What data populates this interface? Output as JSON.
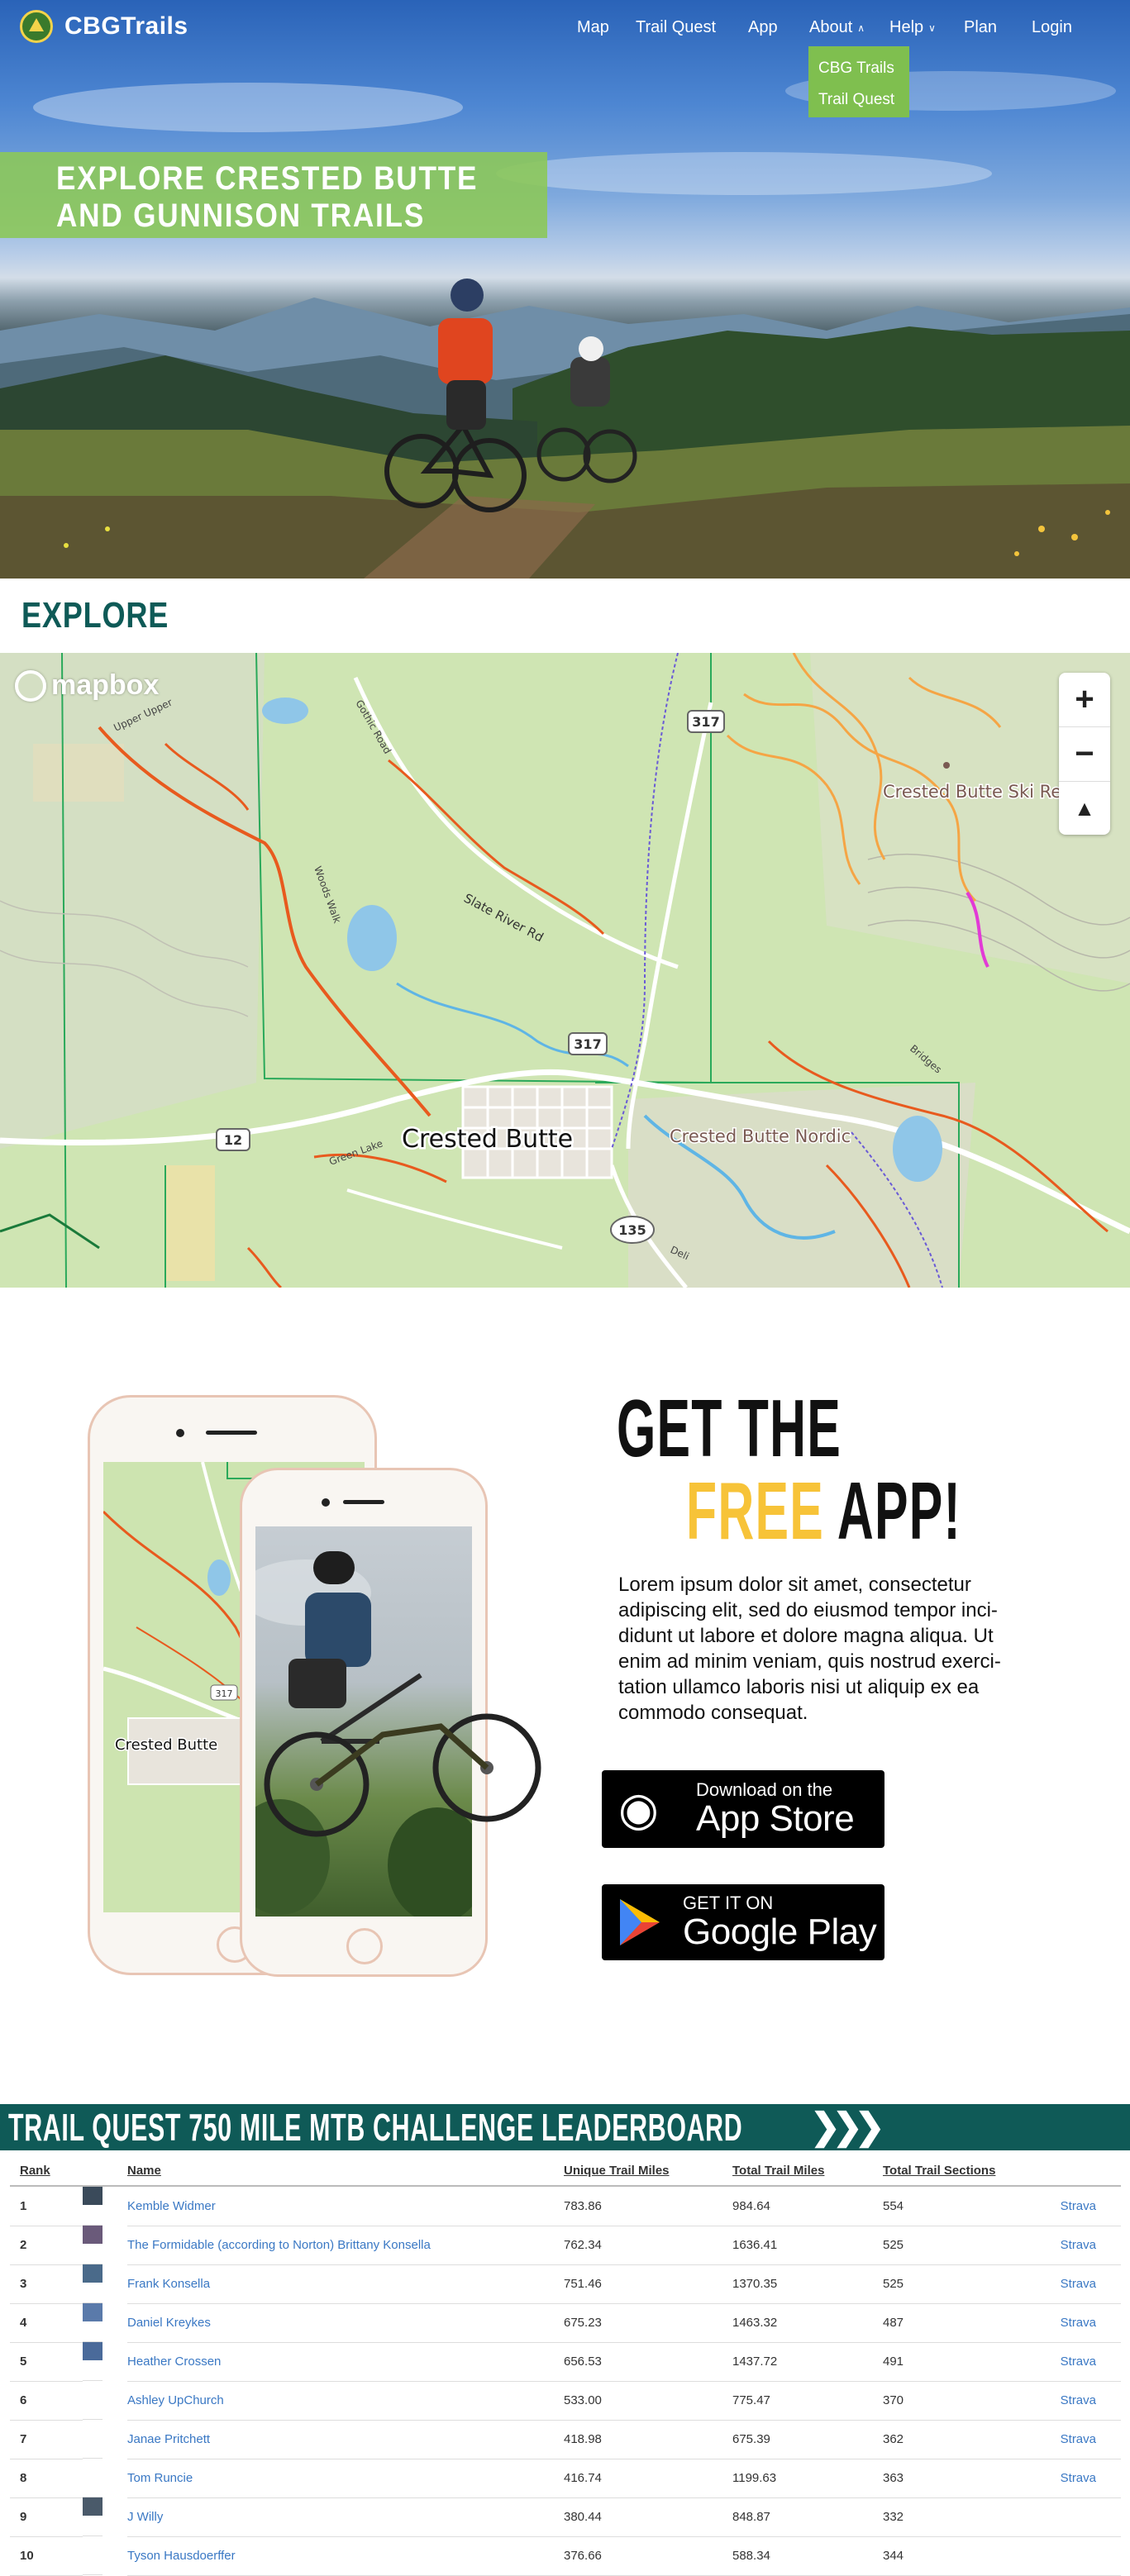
{
  "brand": {
    "name": "CBGTrails",
    "accent": "#7fbf4f",
    "dark_teal": "#0f5a57",
    "yellow": "#f7c338"
  },
  "nav": {
    "items": [
      {
        "label": "Map"
      },
      {
        "label": "Trail Quest"
      },
      {
        "label": "App"
      },
      {
        "label": "About",
        "has_caret": true
      },
      {
        "label": "Help",
        "has_caret": true
      },
      {
        "label": "Plan"
      },
      {
        "label": "Login"
      }
    ],
    "about_dropdown": [
      "CBG Trails",
      "Trail Quest"
    ]
  },
  "hero": {
    "title": "Explore Crested Butte and Gunnison Trails"
  },
  "explore": {
    "heading": "EXPLORE",
    "map": {
      "attribution": "mapbox",
      "labels": [
        "Crested Butte",
        "Crested Butte Ski Resort",
        "Crested Butte Nordic",
        "Slate River Rd",
        "Gothic Road",
        "Upper Upper",
        "Woods Walk",
        "Green Lake",
        "Deli",
        "Bridges"
      ],
      "road_shields": [
        "317",
        "317",
        "12",
        "135"
      ],
      "controls": {
        "zoom_in": "+",
        "zoom_out": "−",
        "compass": "▲"
      }
    }
  },
  "promo": {
    "line1": "GET THE",
    "free_word": "FREE",
    "app_word": "APP!",
    "body": "Lorem ipsum dolor sit amet, consectetur adipiscing elit, sed do eiusmod tempor inci-didunt ut labore et dolore magna aliqua. Ut enim ad minim veniam, quis nostrud exerci-tation ullamco laboris nisi ut aliquip ex ea commodo consequat.",
    "phone_map_label": "Crested Butte",
    "appstore": {
      "small": "Download on the",
      "big": "App Store"
    },
    "googleplay": {
      "small": "GET IT ON",
      "big": "Google Play"
    }
  },
  "leaderboard": {
    "title": "TRAIL QUEST 750 MILE MTB CHALLENGE LEADERBOARD",
    "columns": {
      "rank": "Rank",
      "name": "Name",
      "unique": "Unique Trail Miles",
      "total": "Total Trail Miles",
      "sections": "Total Trail Sections"
    },
    "rows": [
      {
        "rank": "1",
        "name": "Kemble Widmer",
        "unique": "783.86",
        "total": "984.64",
        "sections": "554",
        "strava": "Strava",
        "has_avatar": true
      },
      {
        "rank": "2",
        "name": "The Formidable (according to Norton) Brittany Konsella",
        "unique": "762.34",
        "total": "1636.41",
        "sections": "525",
        "strava": "Strava",
        "has_avatar": true
      },
      {
        "rank": "3",
        "name": "Frank Konsella",
        "unique": "751.46",
        "total": "1370.35",
        "sections": "525",
        "strava": "Strava",
        "has_avatar": true
      },
      {
        "rank": "4",
        "name": "Daniel Kreykes",
        "unique": "675.23",
        "total": "1463.32",
        "sections": "487",
        "strava": "Strava",
        "has_avatar": true
      },
      {
        "rank": "5",
        "name": "Heather Crossen",
        "unique": "656.53",
        "total": "1437.72",
        "sections": "491",
        "strava": "Strava",
        "has_avatar": true
      },
      {
        "rank": "6",
        "name": "Ashley UpChurch",
        "unique": "533.00",
        "total": "775.47",
        "sections": "370",
        "strava": "Strava",
        "has_avatar": false
      },
      {
        "rank": "7",
        "name": "Janae Pritchett",
        "unique": "418.98",
        "total": "675.39",
        "sections": "362",
        "strava": "Strava",
        "has_avatar": false
      },
      {
        "rank": "8",
        "name": "Tom Runcie",
        "unique": "416.74",
        "total": "1199.63",
        "sections": "363",
        "strava": "Strava",
        "has_avatar": false
      },
      {
        "rank": "9",
        "name": "J Willy",
        "unique": "380.44",
        "total": "848.87",
        "sections": "332",
        "strava": "",
        "has_avatar": true
      },
      {
        "rank": "10",
        "name": "Tyson Hausdoerffer",
        "unique": "376.66",
        "total": "588.34",
        "sections": "344",
        "strava": "",
        "has_avatar": false
      }
    ]
  }
}
